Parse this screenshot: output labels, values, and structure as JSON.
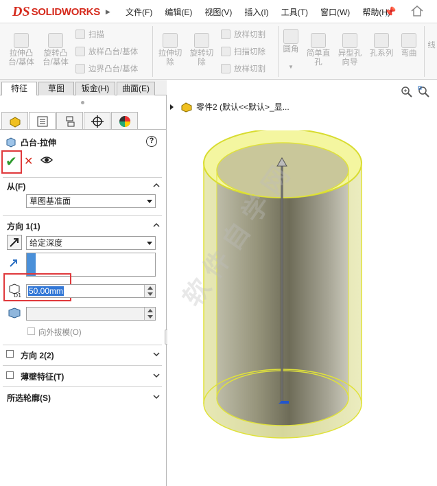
{
  "app": {
    "brand_prefix": "DS",
    "brand_name": "SOLIDWORKS"
  },
  "menu": [
    "文件(F)",
    "编辑(E)",
    "视图(V)",
    "插入(I)",
    "工具(T)",
    "窗口(W)",
    "帮助(H)"
  ],
  "toolbar": {
    "extrude_boss": "拉伸凸\n台/基体",
    "revolve_boss": "旋转凸\n台/基体",
    "sweep": "扫描",
    "loft_boss": "放样凸台/基体",
    "boundary_boss": "边界凸台/基体",
    "extrude_cut": "拉伸切\n除",
    "revolve_cut": "旋转切\n除",
    "loft_cut": "放样切割",
    "sweep_cut": "扫描切除",
    "loft_cut2": "放样切割",
    "fillet": "圆角",
    "simple_hole": "简单直\n孔",
    "hole_wizard": "异型孔\n向导",
    "hole_series": "孔系列",
    "bend": "弯曲",
    "cut_label": "线"
  },
  "tabs": [
    "特征",
    "草图",
    "钣金(H)",
    "曲面(E)"
  ],
  "feature": {
    "title": "凸台-拉伸",
    "help": "?"
  },
  "from": {
    "title": "从(F)",
    "value": "草图基准面"
  },
  "direction1": {
    "title": "方向 1(1)",
    "end_condition": "给定深度",
    "depth": "50.00mm",
    "draft_outward": "向外拔模(O)"
  },
  "direction2": {
    "title": "方向 2(2)"
  },
  "thin_feature": {
    "title": "薄壁特征(T)"
  },
  "selected_contours": {
    "title": "所选轮廓(S)"
  },
  "viewport": {
    "tree_label": "零件2 (默认<<默认>_显...",
    "watermark": "软件自学网"
  }
}
